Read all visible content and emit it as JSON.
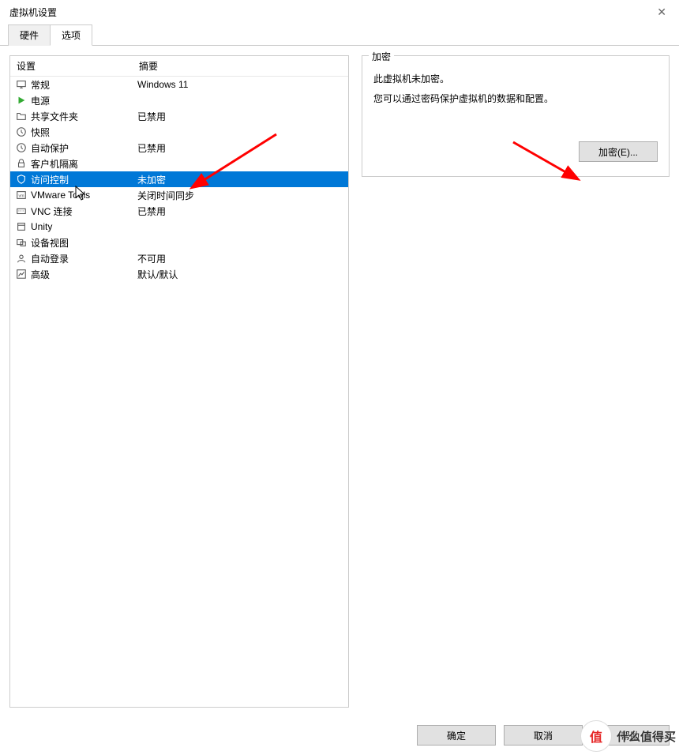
{
  "window": {
    "title": "虚拟机设置",
    "close_glyph": "✕"
  },
  "tabs": {
    "hardware": "硬件",
    "options": "选项"
  },
  "list": {
    "header_setting": "设置",
    "header_summary": "摘要",
    "rows": [
      {
        "icon": "monitor-icon",
        "label": "常规",
        "summary": "Windows 11"
      },
      {
        "icon": "play-icon",
        "label": "电源",
        "summary": ""
      },
      {
        "icon": "folder-share-icon",
        "label": "共享文件夹",
        "summary": "已禁用"
      },
      {
        "icon": "clock-icon",
        "label": "快照",
        "summary": ""
      },
      {
        "icon": "clock-icon",
        "label": "自动保护",
        "summary": "已禁用"
      },
      {
        "icon": "lock-icon",
        "label": "客户机隔离",
        "summary": ""
      },
      {
        "icon": "shield-icon",
        "label": "访问控制",
        "summary": "未加密",
        "selected": true
      },
      {
        "icon": "vm-icon",
        "label": "VMware Tools",
        "summary": "关闭时间同步"
      },
      {
        "icon": "keyboard-icon",
        "label": "VNC 连接",
        "summary": "已禁用"
      },
      {
        "icon": "window-icon",
        "label": "Unity",
        "summary": ""
      },
      {
        "icon": "devices-icon",
        "label": "设备视图",
        "summary": ""
      },
      {
        "icon": "login-icon",
        "label": "自动登录",
        "summary": "不可用"
      },
      {
        "icon": "chart-icon",
        "label": "高级",
        "summary": "默认/默认"
      }
    ]
  },
  "rightPanel": {
    "group_title": "加密",
    "line1": "此虚拟机未加密。",
    "line2": "您可以通过密码保护虚拟机的数据和配置。",
    "encrypt_button": "加密(E)..."
  },
  "buttons": {
    "ok": "确定",
    "cancel": "取消",
    "help": "帮助"
  },
  "watermark": {
    "badge": "值",
    "text": "什么值得买"
  },
  "colors": {
    "selection": "#0078d7",
    "border": "#cccccc",
    "annotation": "#ff0000"
  }
}
